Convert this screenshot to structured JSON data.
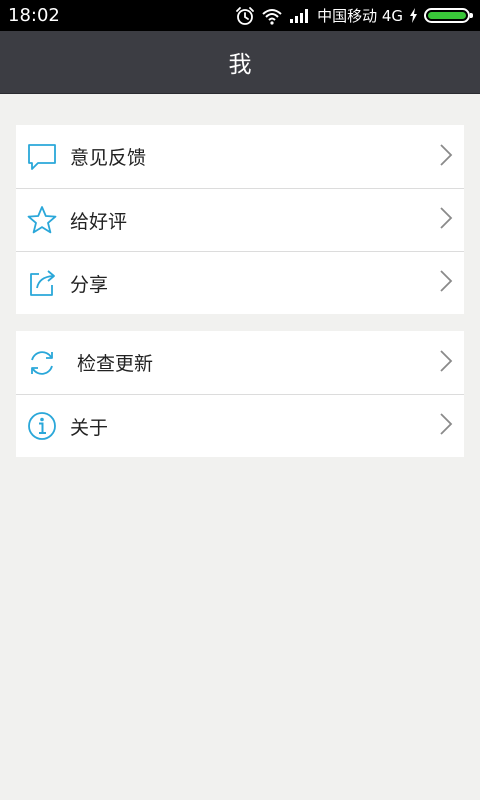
{
  "status_bar": {
    "time": "18:02",
    "carrier": "中国移动 4G",
    "icons": [
      "alarm-icon",
      "wifi-icon",
      "signal-icon",
      "charging-icon",
      "battery-icon"
    ],
    "battery_color": "#39c639"
  },
  "header": {
    "title": "我"
  },
  "groups": [
    {
      "items": [
        {
          "label": "意见反馈",
          "icon": "feedback-icon"
        },
        {
          "label": "给好评",
          "icon": "star-icon"
        },
        {
          "label": "分享",
          "icon": "share-icon"
        }
      ]
    },
    {
      "items": [
        {
          "label": "检查更新",
          "icon": "refresh-icon"
        },
        {
          "label": "关于",
          "icon": "info-icon"
        }
      ]
    }
  ],
  "colors": {
    "accent": "#2aa7d9",
    "header_bg": "#3c3d43",
    "page_bg": "#f1f1ef"
  }
}
